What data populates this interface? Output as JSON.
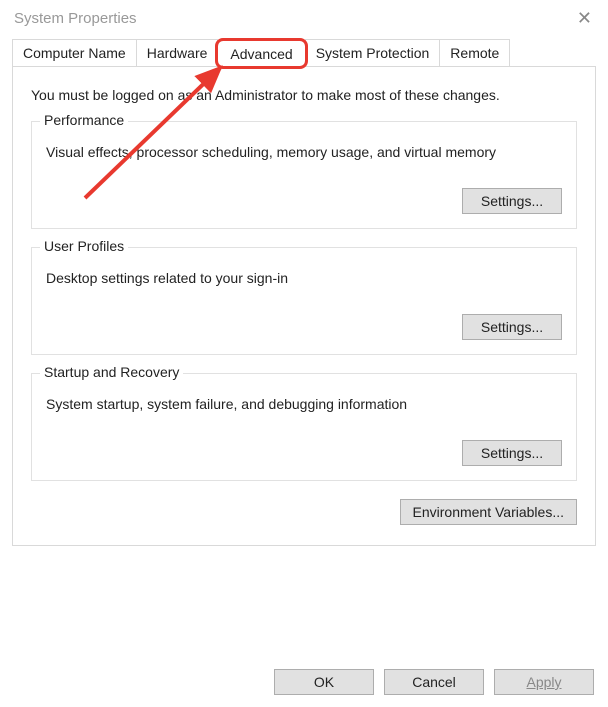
{
  "window": {
    "title": "System Properties"
  },
  "tabs": {
    "computer_name": "Computer Name",
    "hardware": "Hardware",
    "advanced": "Advanced",
    "system_protection": "System Protection",
    "remote": "Remote"
  },
  "panel": {
    "instruction": "You must be logged on as an Administrator to make most of these changes.",
    "performance": {
      "legend": "Performance",
      "desc": "Visual effects, processor scheduling, memory usage, and virtual memory",
      "settings_label": "Settings..."
    },
    "user_profiles": {
      "legend": "User Profiles",
      "desc": "Desktop settings related to your sign-in",
      "settings_label": "Settings..."
    },
    "startup_recovery": {
      "legend": "Startup and Recovery",
      "desc": "System startup, system failure, and debugging information",
      "settings_label": "Settings..."
    },
    "env_vars_label": "Environment Variables..."
  },
  "buttons": {
    "ok": "OK",
    "cancel": "Cancel",
    "apply": "Apply"
  },
  "annotation": {
    "highlight_color": "#e8392f"
  }
}
